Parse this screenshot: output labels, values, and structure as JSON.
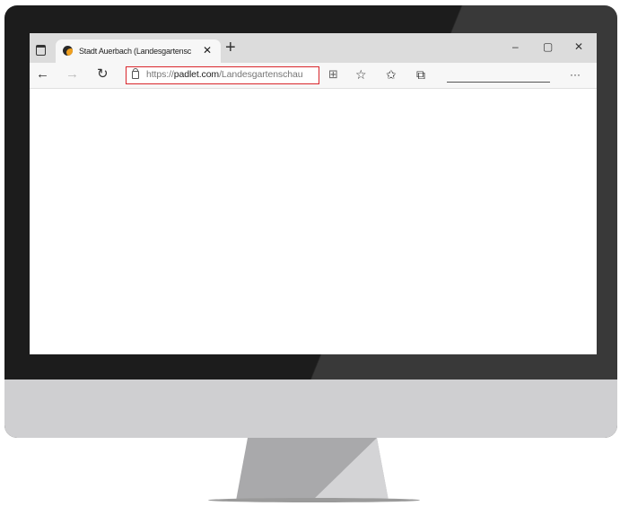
{
  "browser": {
    "tab": {
      "title": "Stadt Auerbach (Landesgartensc",
      "close": "✕"
    },
    "new_tab": "+",
    "window_controls": {
      "minimize": "–",
      "maximize": "▢",
      "close": "✕"
    },
    "nav": {
      "back": "←",
      "forward": "→",
      "refresh": "↻"
    },
    "address": {
      "scheme": "https://",
      "domain": "padlet.com",
      "path": "/Landesgartenschau"
    },
    "tools": {
      "split": "⊞",
      "favorite_add": "☆",
      "favorites": "✩",
      "collections": "⧉",
      "more": "···"
    },
    "colors": {
      "address_highlight": "#d9262c"
    }
  }
}
